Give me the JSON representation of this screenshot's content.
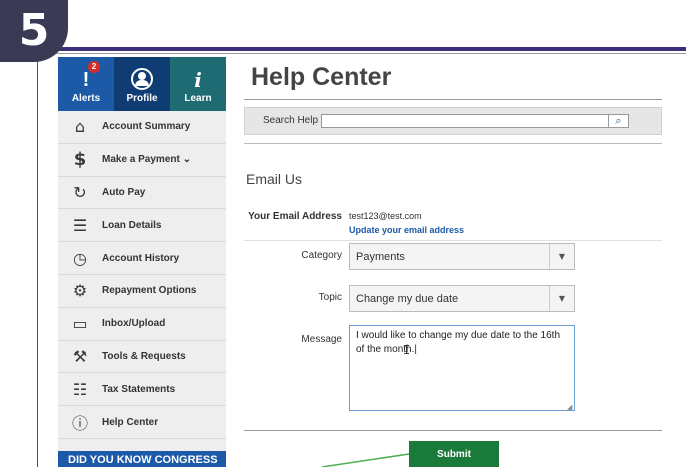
{
  "step_number": "5",
  "colors": {
    "primary_blue": "#1c5aa8",
    "submit_green": "#1a7a3a",
    "badge_bg": "#3a3a55"
  },
  "sidebar": {
    "tabs": [
      {
        "label": "Alerts",
        "icon": "exclamation-icon",
        "badge": "2"
      },
      {
        "label": "Profile",
        "icon": "user-icon"
      },
      {
        "label": "Learn",
        "icon": "info-icon"
      }
    ],
    "items": [
      {
        "label": "Account Summary",
        "icon": "home-icon"
      },
      {
        "label": "Make a Payment ⌄",
        "icon": "dollar-icon"
      },
      {
        "label": "Auto Pay",
        "icon": "autopay-icon"
      },
      {
        "label": "Loan Details",
        "icon": "list-icon"
      },
      {
        "label": "Account History",
        "icon": "history-icon"
      },
      {
        "label": "Repayment Options",
        "icon": "gear-icon"
      },
      {
        "label": "Inbox/Upload",
        "icon": "inbox-icon"
      },
      {
        "label": "Tools & Requests",
        "icon": "wrench-icon"
      },
      {
        "label": "Tax Statements",
        "icon": "document-icon"
      },
      {
        "label": "Help Center",
        "icon": "help-icon"
      }
    ],
    "banner": "DID YOU KNOW CONGRESS"
  },
  "main": {
    "title": "Help Center",
    "search": {
      "label": "Search Help",
      "placeholder": "",
      "value": ""
    },
    "section_title": "Email Us",
    "form": {
      "email_label": "Your Email Address",
      "email_value": "test123@test.com",
      "email_link": "Update your email address",
      "category_label": "Category",
      "category_value": "Payments",
      "topic_label": "Topic",
      "topic_value": "Change my due date",
      "message_label": "Message",
      "message_value": "I would like to change my due date to the 16th of the month.|"
    },
    "submit_label": "Submit"
  }
}
